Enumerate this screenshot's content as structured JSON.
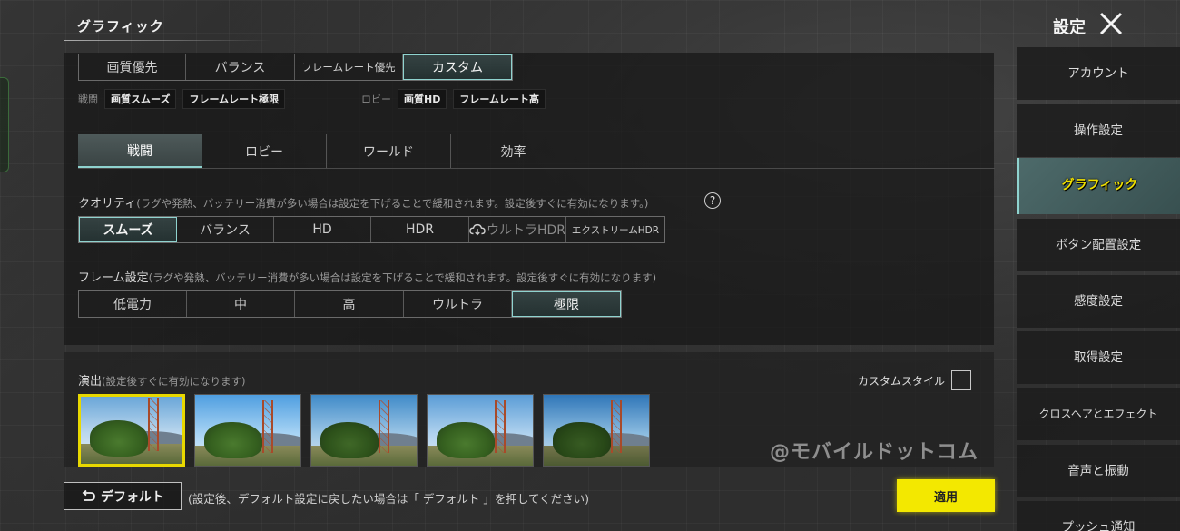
{
  "header": {
    "page_title": "グラフィック",
    "settings_title": "設定"
  },
  "presets": {
    "options": [
      "画質優先",
      "バランス",
      "フレームレート優先",
      "カスタム"
    ],
    "selected": "カスタム"
  },
  "preset_info": {
    "battle_label": "戦闘",
    "battle_tags": [
      "画質スムーズ",
      "フレームレート極限"
    ],
    "lobby_label": "ロビー",
    "lobby_tags": [
      "画質HD",
      "フレームレート高"
    ]
  },
  "tabs": {
    "items": [
      "戦闘",
      "ロビー",
      "ワールド",
      "効率"
    ],
    "selected": "戦闘"
  },
  "quality": {
    "title": "クオリティ",
    "note": "(ラグや発熱、バッテリー消費が多い場合は設定を下げることで緩和されます。設定後すぐに有効になります。)",
    "help": "?",
    "options": [
      "スムーズ",
      "バランス",
      "HD",
      "HDR",
      "ウルトラHDR",
      "エクストリームHDR"
    ],
    "selected": "スムーズ"
  },
  "frame": {
    "title": "フレーム設定",
    "note": "(ラグや発熱、バッテリー消費が多い場合は設定を下げることで緩和されます。設定後すぐに有効になります)",
    "options": [
      "低電力",
      "中",
      "高",
      "ウルトラ",
      "極限"
    ],
    "selected": "極限"
  },
  "effects": {
    "title": "演出",
    "note": "(設定後すぐに有効になります)",
    "custom_style_label": "カスタムスタイル",
    "selected_thumb": 0
  },
  "watermark": "@モバイルドットコム",
  "bottom": {
    "default_label": "デフォルト",
    "default_note": "(設定後、デフォルト設定に戻したい場合は「 デフォルト 」を押してください)",
    "apply_label": "適用"
  },
  "sidebar": {
    "items": [
      "アカウント",
      "操作設定",
      "グラフィック",
      "ボタン配置設定",
      "感度設定",
      "取得設定",
      "クロスヘアとエフェクト",
      "音声と振動",
      "プッシュ通知"
    ],
    "selected": "グラフィック"
  },
  "colors": {
    "accent": "#8fd3cf",
    "apply": "#f3e800",
    "selected_thumb_border": "#e8d800"
  }
}
